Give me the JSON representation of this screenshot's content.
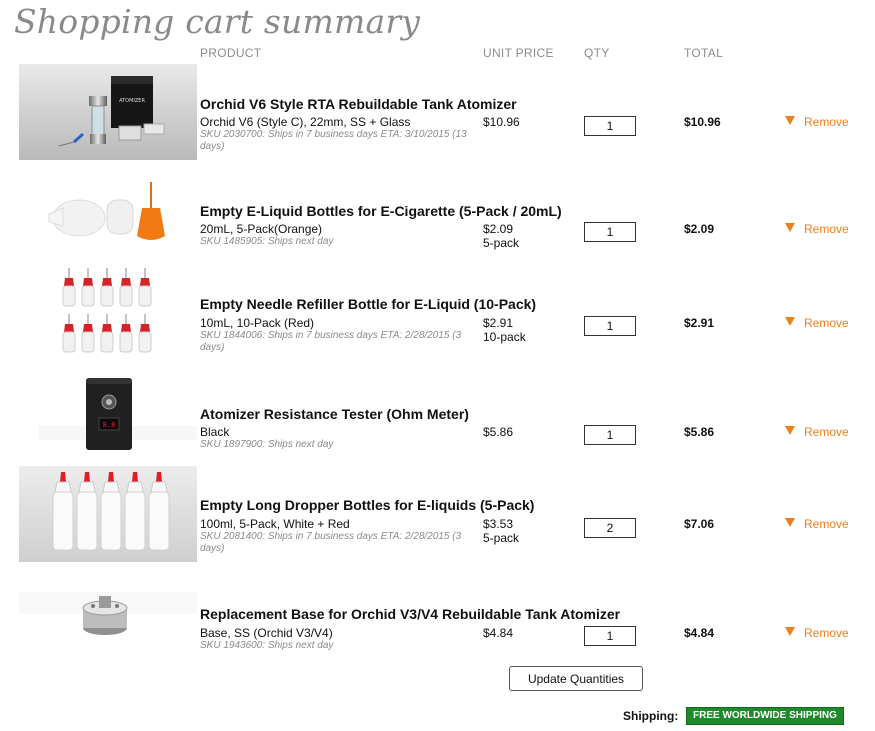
{
  "page": {
    "title": "Shopping cart summary"
  },
  "columns": {
    "product": "PRODUCT",
    "unit_price": "UNIT PRICE",
    "qty": "QTY",
    "total": "TOTAL"
  },
  "items": [
    {
      "name": "Orchid V6 Style RTA Rebuildable Tank Atomizer",
      "variant": "Orchid V6 (Style C), 22mm, SS + Glass",
      "meta": "SKU 2030700: Ships in 7 business days ETA: 3/10/2015 (13 days)",
      "unit_price": "$10.96",
      "pack": "",
      "qty": "1",
      "total": "$10.96",
      "remove": "Remove"
    },
    {
      "name": "Empty E-Liquid Bottles for E-Cigarette (5-Pack / 20mL)",
      "variant": "20mL, 5-Pack(Orange)",
      "meta": "SKU 1485905: Ships next day",
      "unit_price": "$2.09",
      "pack": "5-pack",
      "qty": "1",
      "total": "$2.09",
      "remove": "Remove"
    },
    {
      "name": "Empty Needle Refiller Bottle for E-Liquid (10-Pack)",
      "variant": "10mL, 10-Pack (Red)",
      "meta": "SKU 1844006: Ships in 7 business days ETA: 2/28/2015 (3 days)",
      "unit_price": "$2.91",
      "pack": "10-pack",
      "qty": "1",
      "total": "$2.91",
      "remove": "Remove"
    },
    {
      "name": "Atomizer Resistance Tester (Ohm Meter)",
      "variant": "Black",
      "meta": "SKU 1897900: Ships next day",
      "unit_price": "$5.86",
      "pack": "",
      "qty": "1",
      "total": "$5.86",
      "remove": "Remove"
    },
    {
      "name": "Empty Long Dropper Bottles for E-liquids (5-Pack)",
      "variant": "100ml, 5-Pack, White + Red",
      "meta": "SKU 2081400: Ships in 7 business days ETA: 2/28/2015 (3 days)",
      "unit_price": "$3.53",
      "pack": "5-pack",
      "qty": "2",
      "total": "$7.06",
      "remove": "Remove"
    },
    {
      "name": "Replacement Base for Orchid V3/V4 Rebuildable Tank Atomizer",
      "variant": "Base, SS (Orchid V3/V4)",
      "meta": "SKU 1943600: Ships next day",
      "unit_price": "$4.84",
      "pack": "",
      "qty": "1",
      "total": "$4.84",
      "remove": "Remove"
    }
  ],
  "actions": {
    "update_label": "Update Quantities"
  },
  "shipping": {
    "label": "Shipping:",
    "badge": "FREE WORLDWIDE SHIPPING",
    "badge_color": "#1f8a2c"
  },
  "colors": {
    "accent": "#ef7f1a",
    "title": "#8a8a8a"
  },
  "icons": {
    "remove": "orange-down-triangle-icon"
  }
}
